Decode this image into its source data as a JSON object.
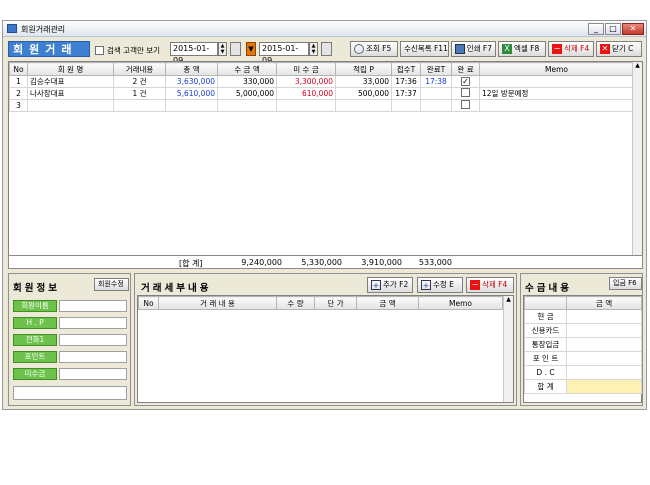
{
  "window": {
    "title": "회원거래관리",
    "min": "_",
    "max": "□",
    "close": "✕"
  },
  "header": {
    "title": "회원거래",
    "checkbox_label": "검색 고객만 보기",
    "date_from": "2015-01-09",
    "date_to": "2015-01-09"
  },
  "toolbar": [
    {
      "label": "조회 F5",
      "icon": "search-icon"
    },
    {
      "label": "수신목록 F11",
      "icon": ""
    },
    {
      "label": "인쇄 F7",
      "icon": "printer-icon"
    },
    {
      "label": "엑셀 F8",
      "icon": "excel-icon"
    },
    {
      "label": "삭제 F4",
      "icon": "minus-icon"
    },
    {
      "label": "닫기 C",
      "icon": "close-icon"
    }
  ],
  "main_table": {
    "columns": [
      "No",
      "회 원 명",
      "거래내용",
      "총  액",
      "수 금 액",
      "미 수 금",
      "적립 P",
      "접수T",
      "완료T",
      "완 료",
      "Memo"
    ],
    "rows": [
      {
        "no": "1",
        "name": "김승수대표",
        "content": "2 건",
        "total": "3,630,000",
        "paid": "330,000",
        "unpaid": "3,300,000",
        "points": "33,000",
        "recv": "17:36",
        "done": "17:38",
        "checked": true,
        "memo": ""
      },
      {
        "no": "2",
        "name": "나사장대표",
        "content": "1 건",
        "total": "5,610,000",
        "paid": "5,000,000",
        "unpaid": "610,000",
        "points": "500,000",
        "recv": "17:37",
        "done": "",
        "checked": false,
        "memo": "12일 방문예정"
      },
      {
        "no": "3",
        "name": "",
        "content": "",
        "total": "",
        "paid": "",
        "unpaid": "",
        "points": "",
        "recv": "",
        "done": "",
        "checked": false,
        "memo": ""
      }
    ],
    "summary": {
      "label": "[합 계]",
      "total": "9,240,000",
      "paid": "5,330,000",
      "unpaid": "3,910,000",
      "points": "533,000"
    }
  },
  "member_panel": {
    "title": "회원정보",
    "edit_button": "회원수정",
    "fields": [
      "회원이름",
      "H . P",
      "전화1",
      "포인트",
      "미수금"
    ]
  },
  "detail_panel": {
    "title": "거래세부내용",
    "buttons": [
      {
        "label": "추가 F2",
        "icon": "plus-icon"
      },
      {
        "label": "수정 E",
        "icon": "plus-icon"
      },
      {
        "label": "삭제 F4",
        "icon": "minus-icon"
      }
    ],
    "columns": [
      "No",
      "거 래 내 용",
      "수 량",
      "단  가",
      "금  액",
      "Memo"
    ]
  },
  "payment_panel": {
    "title": "수금내용",
    "button": "입금 F6",
    "header": "금  액",
    "rows": [
      "현  금",
      "신용카드",
      "통장입금",
      "포 인 트",
      "D . C",
      "합  계"
    ]
  }
}
